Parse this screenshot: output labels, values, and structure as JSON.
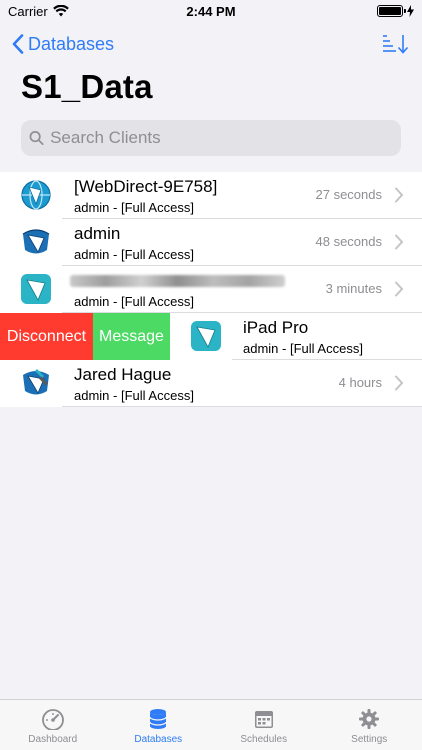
{
  "status_bar": {
    "carrier": "Carrier",
    "time": "2:44 PM",
    "battery_percent": 100
  },
  "nav": {
    "back_label": "Databases"
  },
  "page": {
    "title": "S1_Data"
  },
  "search": {
    "placeholder": "Search Clients",
    "value": ""
  },
  "clients": [
    {
      "name": "[WebDirect-9E758]",
      "access": "admin - [Full Access]",
      "time": "27 seconds",
      "icon": "webdirect-globe-icon"
    },
    {
      "name": "admin",
      "access": "admin - [Full Access]",
      "time": "48 seconds",
      "icon": "filemaker-pro-icon"
    },
    {
      "name": "",
      "access": "admin - [Full Access]",
      "time": "3 minutes",
      "icon": "filemaker-go-icon",
      "name_redacted": true
    },
    {
      "name": "iPad Pro",
      "access": "admin - [Full Access]",
      "time": "",
      "icon": "filemaker-go-icon"
    },
    {
      "name": "Jared Hague",
      "access": "admin - [Full Access]",
      "time": "4 hours",
      "icon": "filemaker-admin-icon"
    }
  ],
  "swipe_actions": {
    "disconnect": "Disconnect",
    "message": "Message"
  },
  "tabs": [
    {
      "label": "Dashboard",
      "active": false
    },
    {
      "label": "Databases",
      "active": true
    },
    {
      "label": "Schedules",
      "active": false
    },
    {
      "label": "Settings",
      "active": false
    }
  ],
  "colors": {
    "accent": "#2f7cf6",
    "disconnect": "#ff3b30",
    "message": "#4cd964",
    "teal_icon": "#2bb3c6"
  }
}
